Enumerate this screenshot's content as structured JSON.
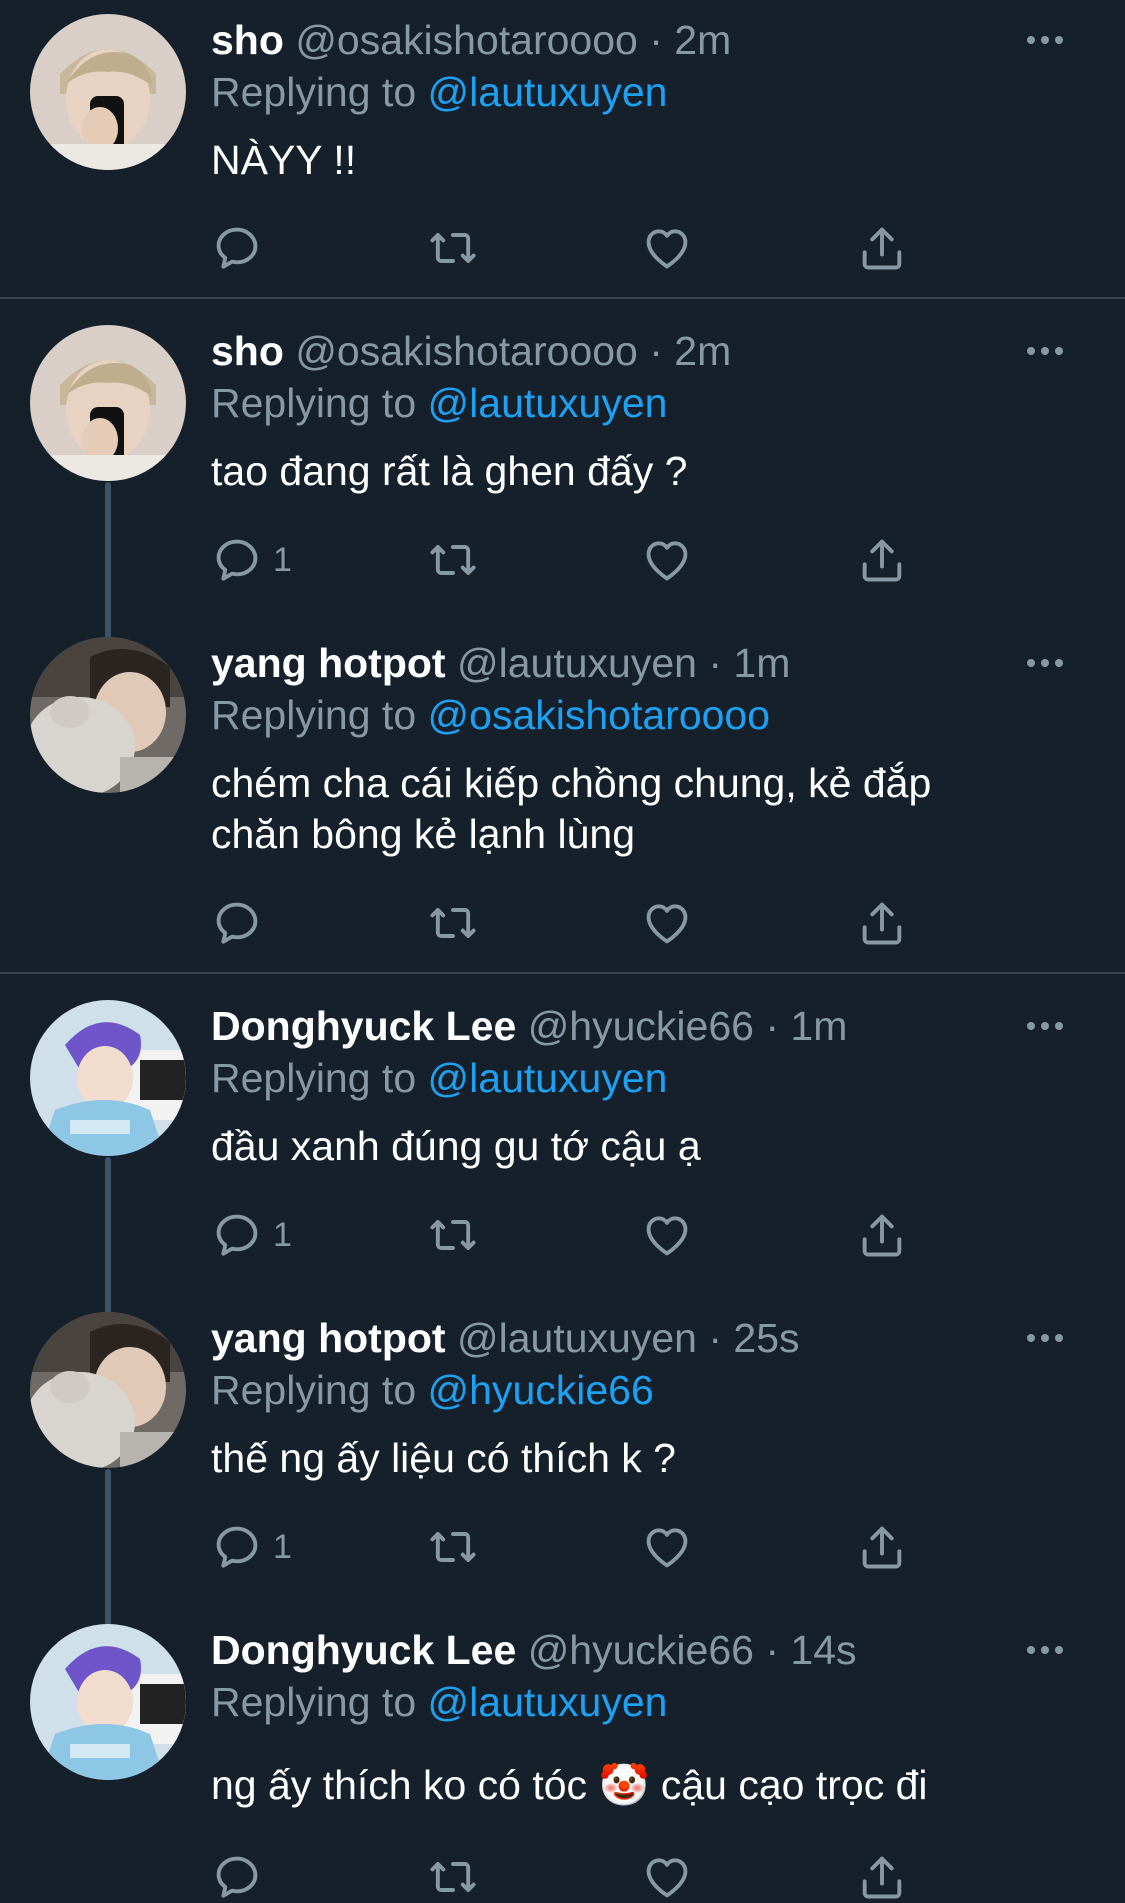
{
  "colors": {
    "background": "#15202b",
    "text_primary": "#ffffff",
    "text_secondary": "#8899a6",
    "mention": "#1da1f2",
    "divider": "#38444d",
    "thread_line": "#3d5466"
  },
  "tweets": [
    {
      "name": "sho",
      "handle": "@osakishotaroooo",
      "separator": "·",
      "time": "2m",
      "replying_prefix": "Replying to",
      "replying_to": "@lautuxuyen",
      "text": "NÀYY !!",
      "reply_count": "",
      "avatar": "sho-avatar"
    },
    {
      "name": "sho",
      "handle": "@osakishotaroooo",
      "separator": "·",
      "time": "2m",
      "replying_prefix": "Replying to",
      "replying_to": "@lautuxuyen",
      "text": "tao đang rất là ghen đấy ?",
      "reply_count": "1",
      "avatar": "sho-avatar"
    },
    {
      "name": "yang hotpot",
      "handle": "@lautuxuyen",
      "separator": "·",
      "time": "1m",
      "replying_prefix": "Replying to",
      "replying_to": "@osakishotaroooo",
      "text": "chém cha cái kiếp chồng chung, kẻ đắp chăn bông kẻ lạnh lùng",
      "reply_count": "",
      "avatar": "yang-avatar"
    },
    {
      "name": "Donghyuck Lee",
      "handle": "@hyuckie66",
      "separator": "·",
      "time": "1m",
      "replying_prefix": "Replying to",
      "replying_to": "@lautuxuyen",
      "text": "đầu xanh đúng gu tớ cậu ạ",
      "reply_count": "1",
      "avatar": "donghyuck-avatar"
    },
    {
      "name": "yang hotpot",
      "handle": "@lautuxuyen",
      "separator": "·",
      "time": "25s",
      "replying_prefix": "Replying to",
      "replying_to": "@hyuckie66",
      "text": "thế ng ấy liệu có thích k ?",
      "reply_count": "1",
      "avatar": "yang-avatar"
    },
    {
      "name": "Donghyuck Lee",
      "handle": "@hyuckie66",
      "separator": "·",
      "time": "14s",
      "replying_prefix": "Replying to",
      "replying_to": "@lautuxuyen",
      "text": "ng ấy thích ko có tóc 🤡 cậu cạo trọc đi",
      "reply_count": "",
      "avatar": "donghyuck-avatar"
    }
  ],
  "icons": {
    "reply": "reply-icon",
    "retweet": "retweet-icon",
    "like": "heart-icon",
    "share": "share-icon",
    "more": "more-options-icon"
  }
}
